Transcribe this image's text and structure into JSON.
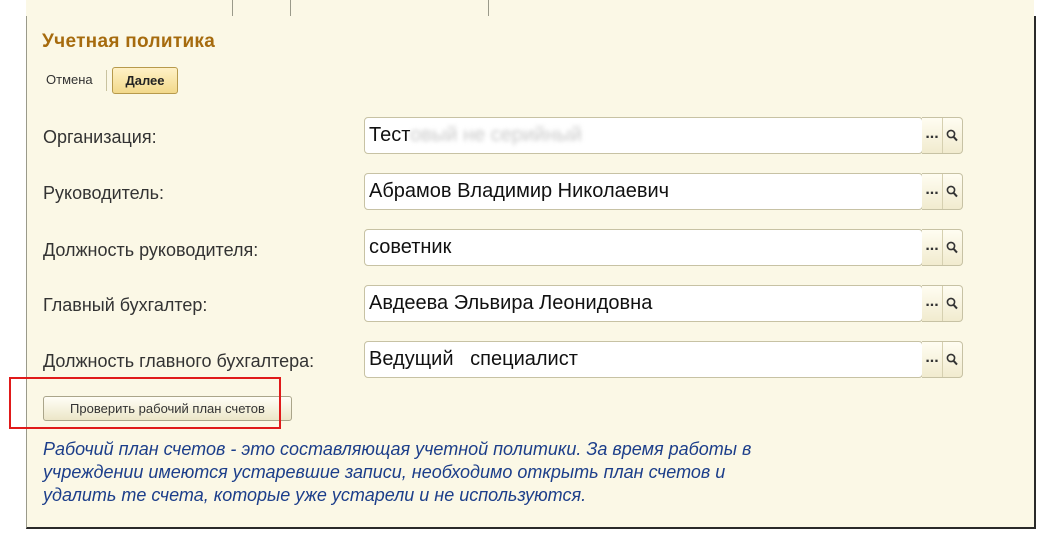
{
  "form": {
    "title": "Учетная политика",
    "commands": {
      "cancel_label": "Отмена",
      "next_label": "Далее"
    }
  },
  "fields": [
    {
      "label": "Организация:",
      "value_clear": "Тест",
      "value_blurred": "овый не серийный"
    },
    {
      "label": "Руководитель:",
      "value": "Абрамов Владимир Николаевич"
    },
    {
      "label": "Должность руководителя:",
      "value": "советник"
    },
    {
      "label": "Главный бухгалтер:",
      "value": "Авдеева Эльвира Леонидовна"
    },
    {
      "label": "Должность главного бухгалтера:",
      "value": "Ведущий   специалист"
    }
  ],
  "field_buttons": {
    "select_label": "...",
    "search_icon": "magnifier-icon"
  },
  "check_button": {
    "label": "Проверить рабочий план счетов"
  },
  "description": {
    "lines": [
      "Рабочий план счетов - это составляющая учетной политики. За время работы в",
      "учреждении имеются устаревшие записи, необходимо открыть план счетов и",
      "удалить те счета, которые уже устарели и не используются."
    ]
  },
  "colors": {
    "title": "#a66b0e",
    "description": "#1c3e8a",
    "highlight": "#e01a1a",
    "form_bg": "#fbf8e6"
  }
}
